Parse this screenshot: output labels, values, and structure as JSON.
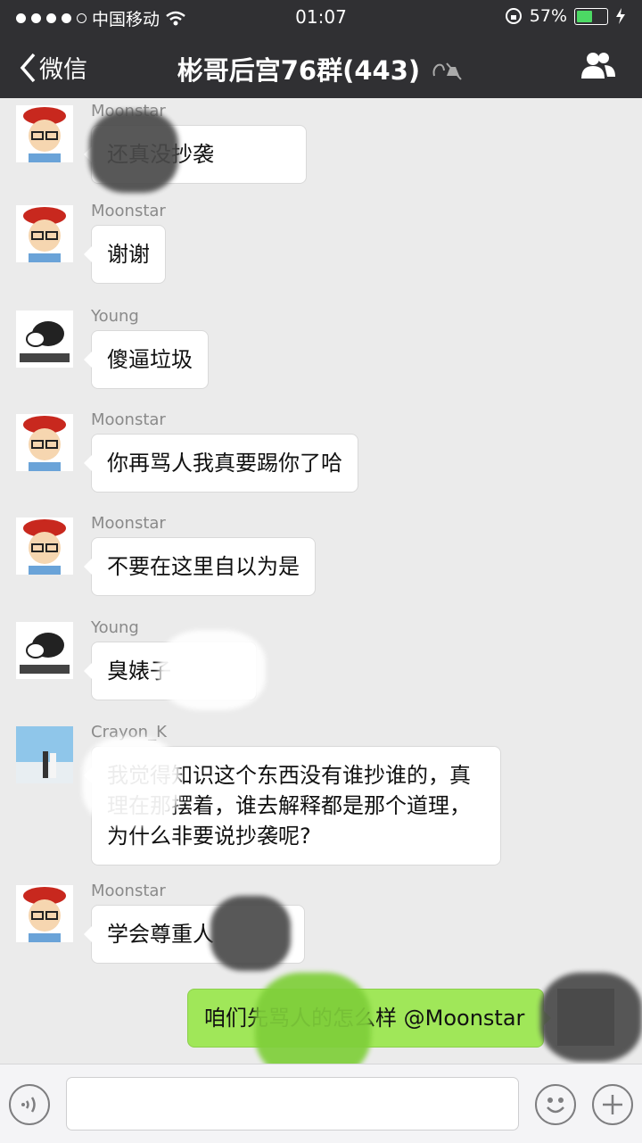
{
  "status": {
    "carrier": "中国移动",
    "time": "01:07",
    "battery": "57%",
    "battery_level": 0.57
  },
  "nav": {
    "back_label": "微信",
    "title": "彬哥后宫76群(443)"
  },
  "messages": [
    {
      "sender": "Moonstar",
      "text": "还真没抄袭"
    },
    {
      "sender": "Moonstar",
      "text": "谢谢"
    },
    {
      "sender": "Young",
      "text": "傻逼垃圾"
    },
    {
      "sender": "Moonstar",
      "text": "你再骂人我真要踢你了哈"
    },
    {
      "sender": "Moonstar",
      "text": "不要在这里自以为是"
    },
    {
      "sender": "Young",
      "text": "臭婊子"
    },
    {
      "sender": "Crayon_K",
      "text": "我觉得知识这个东西没有谁抄谁的，真理在那摆着，谁去解释都是那个道理，为什么非要说抄袭呢?"
    },
    {
      "sender": "Moonstar",
      "text": "学会尊重人"
    }
  ],
  "my_message": {
    "text": "咱们先骂人的怎么样 @Moonstar"
  },
  "colors": {
    "header": "#303033",
    "my_bubble": "#a0e759",
    "background": "#ebebeb"
  },
  "icons": [
    "back-chevron-icon",
    "mute-icon",
    "group-members-icon",
    "voice-icon",
    "emoji-icon",
    "plus-icon"
  ]
}
